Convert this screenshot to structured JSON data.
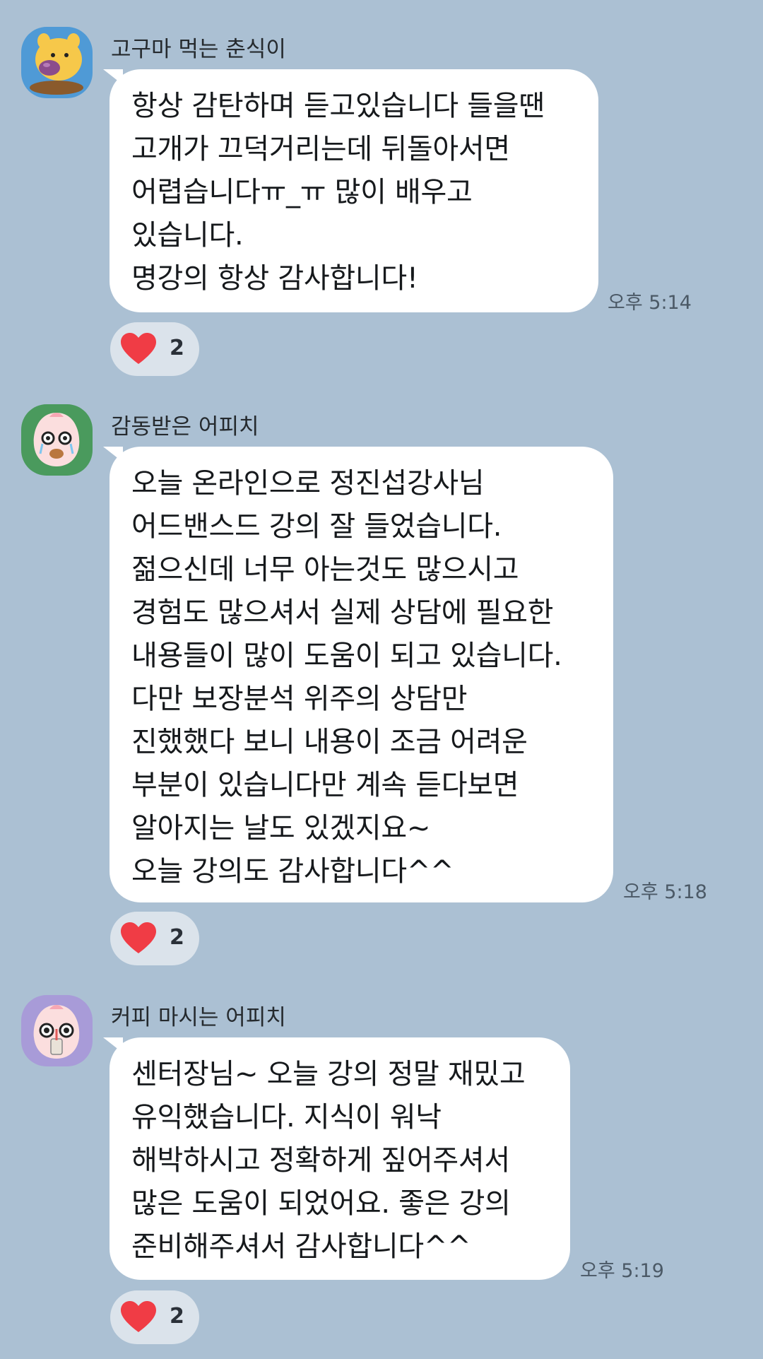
{
  "messages": [
    {
      "sender": "고구마 먹는 춘식이",
      "avatar_icon": "chunsik-sweet-potato-avatar-icon",
      "avatar_bg": "#4f9ad6",
      "lines": [
        "항상 감탄하며 듣고있습니다 들을땐",
        "고개가 끄덕거리는데 뒤돌아서면",
        "어렵습니다ㅠ_ㅠ 많이 배우고",
        "있습니다.",
        "명강의 항상 감사합니다!"
      ],
      "time": "오후 5:14",
      "reaction": {
        "icon": "heart-icon",
        "count": "2"
      }
    },
    {
      "sender": "감동받은 어피치",
      "avatar_icon": "apeach-touched-avatar-icon",
      "avatar_bg": "#4a9a5d",
      "lines": [
        "오늘 온라인으로 정진섭강사님",
        "어드밴스드 강의 잘 들었습니다.",
        "젊으신데 너무 아는것도 많으시고",
        "경험도 많으셔서 실제 상담에 필요한",
        "내용들이 많이 도움이 되고 있습니다.",
        "다만 보장분석 위주의 상담만",
        "진했했다 보니 내용이 조금 어려운",
        "부분이 있습니다만 계속 듣다보면",
        "알아지는 날도 있겠지요~",
        "오늘 강의도 감사합니다^^"
      ],
      "time": "오후 5:18",
      "reaction": {
        "icon": "heart-icon",
        "count": "2"
      }
    },
    {
      "sender": "커피 마시는 어피치",
      "avatar_icon": "apeach-coffee-avatar-icon",
      "avatar_bg": "#a89bd8",
      "lines": [
        "센터장님~ 오늘 강의 정말 재밌고",
        "유익했습니다. 지식이 워낙",
        "해박하시고 정확하게 짚어주셔서",
        "많은 도움이 되었어요. 좋은 강의",
        "준비해주셔서 감사합니다^^"
      ],
      "time": "오후 5:19",
      "reaction": {
        "icon": "heart-icon",
        "count": "2"
      }
    }
  ],
  "colors": {
    "chat_background": "#abc0d3",
    "bubble": "#ffffff",
    "reaction_pill": "#dbe3eb",
    "heart": "#f03c45"
  }
}
